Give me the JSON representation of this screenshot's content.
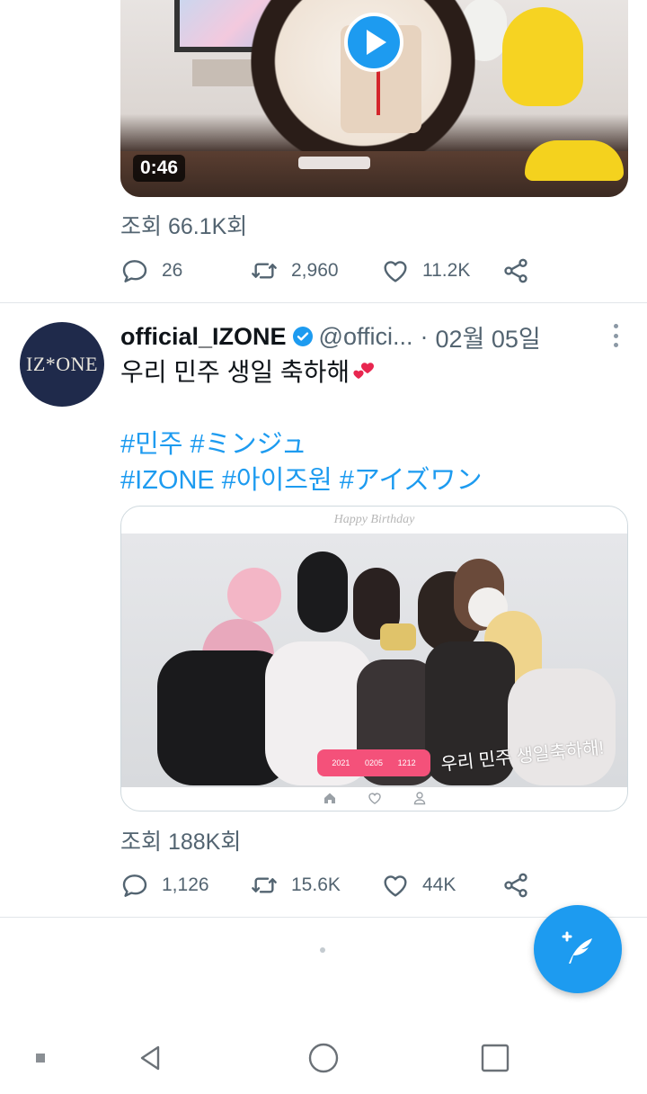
{
  "tweet1": {
    "video_duration": "0:46",
    "views_text": "조회 66.1K회",
    "actions": {
      "replies": "26",
      "retweets": "2,960",
      "likes": "11.2K"
    }
  },
  "tweet2": {
    "avatar_text": "IZ*ONE",
    "display_name": "official_IZONE",
    "handle": "@offici...",
    "separator": "·",
    "time": "02월 05일",
    "text": "우리 민주 생일 축하해",
    "hashtags_line1": "#민주 #ミンジュ",
    "hashtags_line2": "#IZONE #아이즈원 #アイズワン",
    "media": {
      "banner_text": "Happy Birthday",
      "caption": "우리 민주 생일축하해!",
      "pill_year": "2021",
      "pill_date": "0205",
      "pill_num": "1212"
    },
    "views_text": "조회 188K회",
    "actions": {
      "replies": "1,126",
      "retweets": "15.6K",
      "likes": "44K"
    }
  },
  "colors": {
    "accent": "#1d9bf0",
    "muted": "#536471",
    "heart_pink": "#e8264f"
  },
  "icons": [
    "play-icon",
    "reply-icon",
    "retweet-icon",
    "like-icon",
    "share-icon",
    "verified-icon",
    "more-icon",
    "compose-icon",
    "back-icon",
    "home-icon",
    "recents-icon",
    "menu-icon"
  ]
}
